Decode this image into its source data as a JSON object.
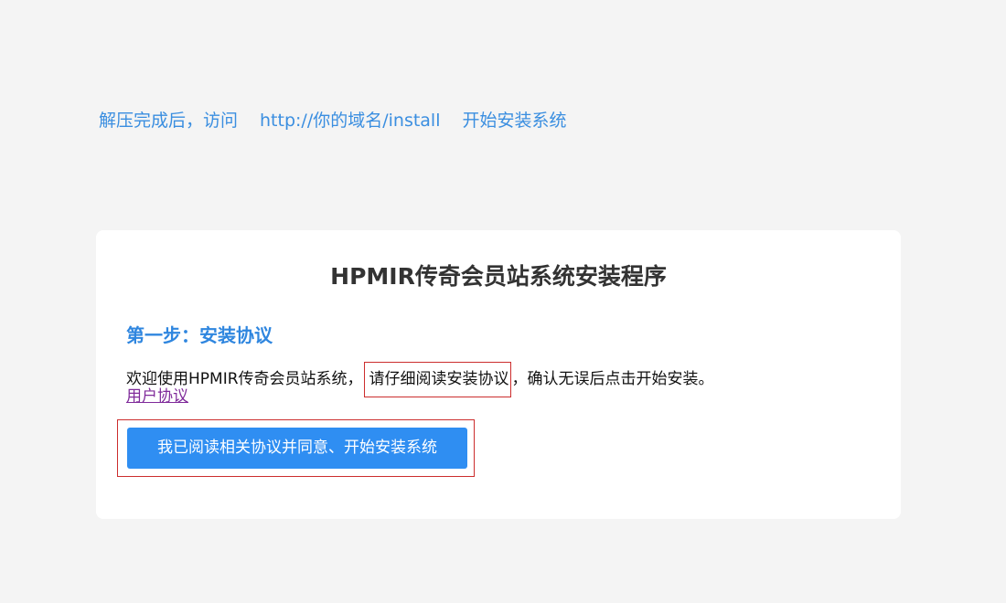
{
  "instruction": {
    "part1": "解压完成后，访问",
    "part2": "http://你的域名/install",
    "part3": "开始安装系统"
  },
  "card": {
    "title": "HPMIR传奇会员站系统安装程序",
    "step_title": "第一步：安装协议",
    "welcome_before": "欢迎使用HPMIR传奇会员站系统，",
    "welcome_highlight": "请仔细阅读安装协议",
    "welcome_after": "，确认无误后点击开始安装。",
    "agreement_link": "用户协议",
    "start_button": "我已阅读相关协议并同意、开始安装系统"
  },
  "colors": {
    "page_background": "#f4f4f4",
    "card_background": "#ffffff",
    "accent_blue": "#2f8ef2",
    "link_purple": "#7f2a9a",
    "annotation_red": "#cc2d2d"
  }
}
